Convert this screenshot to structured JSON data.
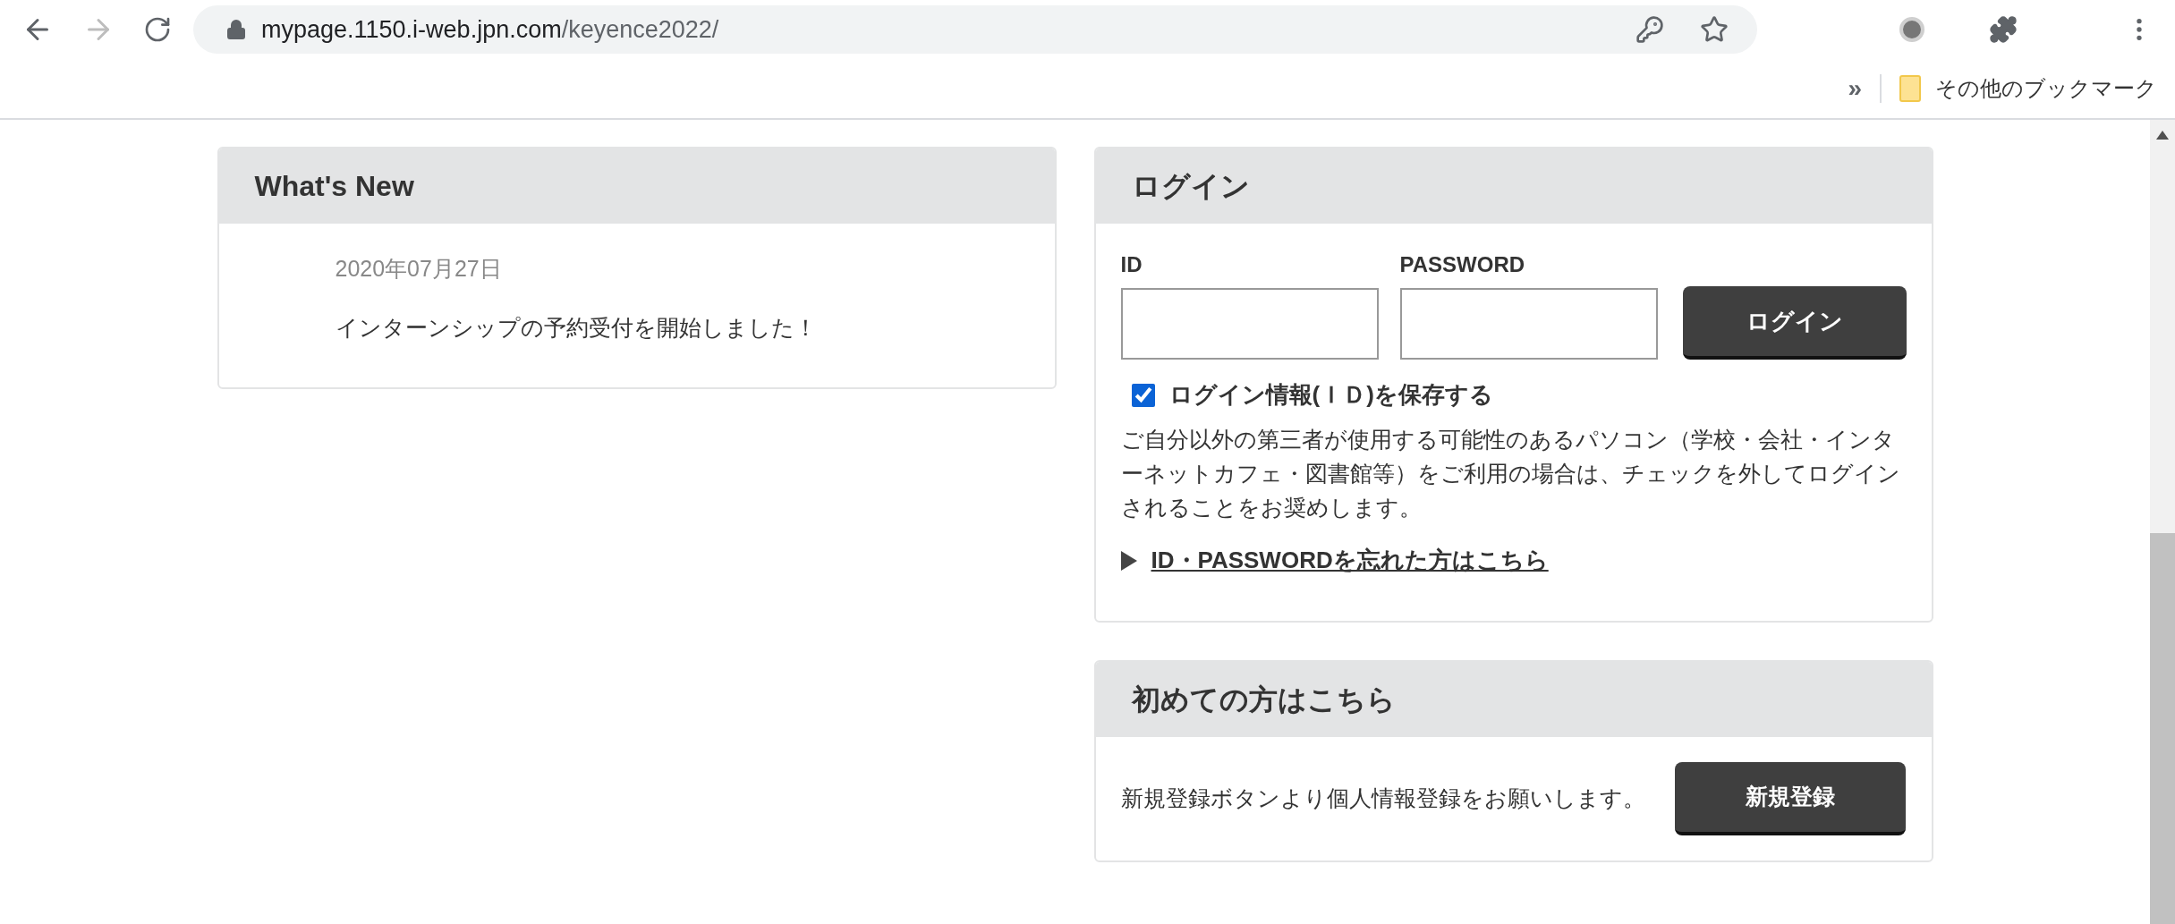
{
  "browser": {
    "url_host": "mypage.1150.i-web.jpn.com",
    "url_path": "/keyence2022/",
    "bookmarks_overflow": "»",
    "bookmark_folder": "その他のブックマーク"
  },
  "whats_new": {
    "title": "What's New",
    "items": [
      {
        "date": "2020年07月27日",
        "text": "インターンシップの予約受付を開始しました！"
      }
    ]
  },
  "login": {
    "title": "ログイン",
    "fields": [
      {
        "label": "ID"
      },
      {
        "label": "PASSWORD"
      }
    ],
    "button": "ログイン",
    "remember": {
      "label": "ログイン情報(ＩＤ)を保存する",
      "checked": true
    },
    "notice": "ご自分以外の第三者が使用する可能性のあるパソコン（学校・会社・インターネットカフェ・図書館等）をご利用の場合は、チェックを外してログインされることをお奨めします。",
    "forgot_link": "ID・PASSWORDを忘れた方はこちら"
  },
  "register": {
    "title": "初めての方はこちら",
    "text": "新規登録ボタンより個人情報登録をお願いします。",
    "button": "新規登録"
  }
}
